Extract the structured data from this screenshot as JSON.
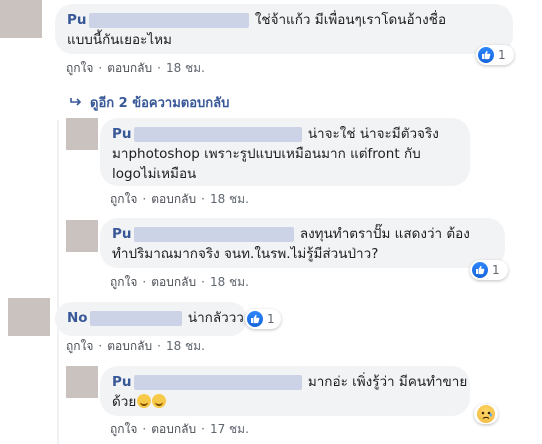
{
  "actions": {
    "like": "ถูกใจ",
    "reply": "ตอบกลับ",
    "sep": "·"
  },
  "comments": [
    {
      "name": "Pu",
      "text_line1": "ใช่จ้าแก้ว มีเพื่อนๆเราโดนอ้างชื่อ",
      "text_line2": "แบบนี้กันเยอะไหม",
      "time": "18 ชม.",
      "reaction_count": "1"
    },
    {
      "replies_link": "ดูอีก 2 ข้อความตอบกลับ"
    },
    {
      "name": "Pu",
      "text_line1": "น่าจะใช่ น่าจะมีตัวจริง",
      "text_line2": "มาphotoshop เพราะรูปแบบเหมือนมาก แต่front กับ",
      "text_line3": "logoไม่เหมือน",
      "time": "18 ชม."
    },
    {
      "name": "Pu",
      "text_line1": "ลงทุนทำตราปั๊ม แสดงว่า ต้อง",
      "text_line2": "ทำปริมาณมากจริง จนท.ในรพ.ไม่รู้มีส่วนป่าว?",
      "time": "18 ชม.",
      "reaction_count": "1"
    },
    {
      "name": "No",
      "text_line1": "น่ากลัววว",
      "time": "18 ชม.",
      "reaction_count": "1"
    },
    {
      "name": "Pu",
      "text_line1": "มากอ่ะ เพิ่งรู้ว่า มีคนทำขาย",
      "text_line2": "ด้วย",
      "time": "17 ชม."
    }
  ],
  "colors": {
    "link": "#385898",
    "bubble": "#f2f3f5",
    "like": "#1877f2"
  }
}
